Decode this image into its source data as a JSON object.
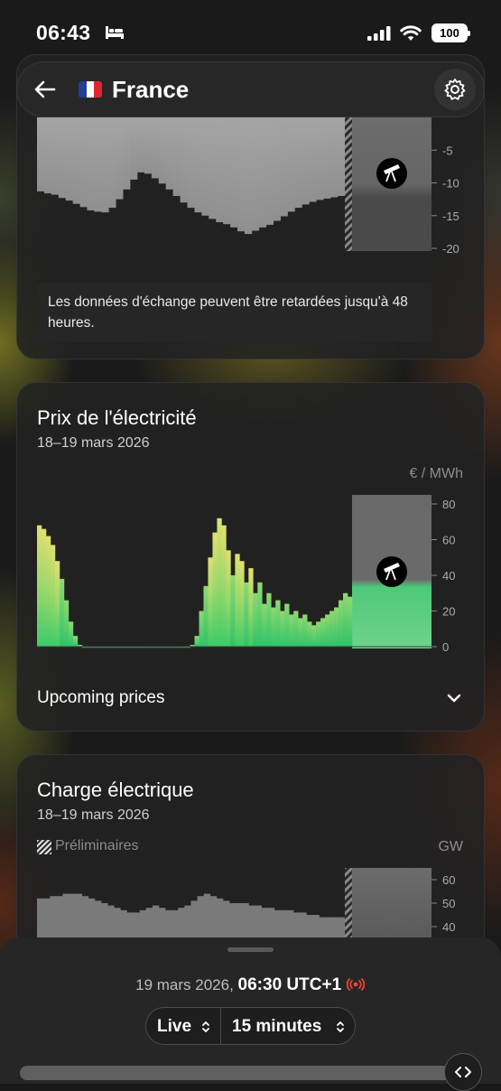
{
  "status_bar": {
    "time": "06:43",
    "battery": "100"
  },
  "header": {
    "country": "France",
    "back_icon": "arrow-left-icon",
    "settings_icon": "gear-icon"
  },
  "exchange_section": {
    "y_ticks": [
      "-5",
      "-10",
      "-15",
      "-20"
    ],
    "note": "Les données d'échange peuvent être retardées jusqu'à 48 heures."
  },
  "price_section": {
    "title": "Prix de l'électricité",
    "date_range": "18–19 mars 2026",
    "unit": "€ / MWh",
    "upcoming_label": "Upcoming prices"
  },
  "load_section": {
    "title": "Charge électrique",
    "date_range": "18–19 mars 2026",
    "preliminary_label": "Préliminaires",
    "unit": "GW"
  },
  "bottom_sheet": {
    "date": "19 mars 2026,",
    "time": "06:30 UTC+1",
    "mode": "Live",
    "interval": "15 minutes"
  },
  "chart_data": [
    {
      "type": "bar",
      "series": [
        {
          "name": "",
          "values": [
            -11.3,
            -11.3,
            -11.6,
            -11.6,
            -11.8,
            -11.8,
            -12.3,
            -12.3,
            -12.7,
            -12.7,
            -13.2,
            -13.2,
            -13.7,
            -13.7,
            -14.2,
            -14.2,
            -14.4,
            -14.4,
            -14.5,
            -14.5,
            -13.8,
            -13.8,
            -12.5,
            -12.5,
            -11,
            -11,
            -9.5,
            -9.5,
            -8.4,
            -8.4,
            -8.6,
            -8.6,
            -9.3,
            -9.3,
            -10.1,
            -10.1,
            -11,
            -11,
            -12,
            -12,
            -13,
            -13,
            -13.8,
            -13.8,
            -14.5,
            -14.5,
            -15,
            -15,
            -15.5,
            -15.5,
            -16,
            -16,
            -16.3,
            -16.3,
            -16.8,
            -16.8,
            -17.4,
            -17.4,
            -17.8,
            -17.8,
            -17.3,
            -17.3,
            -16.8,
            -16.8,
            -16.4,
            -16.4,
            -15.8,
            -15.8,
            -15.1,
            -15.1,
            -14.4,
            -14.4,
            -13.8,
            -13.8,
            -13.3,
            -13.3,
            -12.9,
            -12.9,
            -12.6,
            -12.6,
            -12.4,
            -12.4,
            -12.2,
            -12.2,
            -12,
            -12
          ]
        }
      ],
      "y_ticks": [
        -5,
        -10,
        -15,
        -20
      ],
      "ylim": [
        -22,
        0
      ]
    },
    {
      "type": "bar",
      "series": [
        {
          "name": "",
          "values": [
            68,
            66,
            62,
            57,
            48,
            38,
            26,
            14,
            6,
            1,
            0,
            -0.5,
            -0.5,
            -0.5,
            -0.5,
            -0.6,
            -0.6,
            -0.5,
            -0.4,
            -0.3,
            -0.3,
            -0.3,
            -0.5,
            -0.6,
            -0.5,
            -0.4,
            -0.3,
            -0.3,
            -0.2,
            -0.2,
            -0.2,
            -0.2,
            -0.1,
            0,
            1,
            6,
            20,
            34,
            50,
            64,
            72,
            68,
            54,
            40,
            52,
            48,
            36,
            44,
            30,
            36,
            24,
            30,
            22,
            26,
            20,
            24,
            18,
            20,
            16,
            18,
            14,
            12,
            14,
            16,
            18,
            20,
            22,
            26,
            30,
            28
          ]
        }
      ],
      "y_ticks": [
        0,
        20,
        40,
        60,
        80
      ],
      "ylim": [
        0,
        85
      ]
    },
    {
      "type": "bar",
      "series": [
        {
          "name": "",
          "values": [
            52,
            52,
            53,
            53,
            54,
            54,
            54,
            53,
            52,
            51,
            50,
            49,
            48,
            47,
            46,
            46,
            47,
            48,
            49,
            48,
            47,
            47,
            48,
            49,
            51,
            53,
            54,
            53,
            52,
            51,
            50,
            50,
            50,
            49,
            49,
            48,
            48,
            47,
            47,
            47,
            46,
            46,
            45,
            45,
            44,
            44,
            44,
            44
          ]
        }
      ],
      "y_ticks": [
        40,
        50,
        60
      ],
      "ylim": [
        0,
        66
      ]
    }
  ]
}
